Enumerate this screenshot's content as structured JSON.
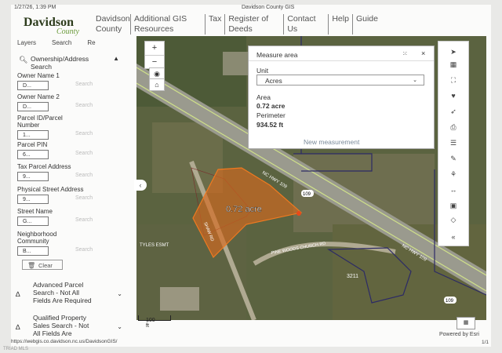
{
  "print_header": {
    "datetime": "1/27/26, 1:39 PM",
    "title": "Davidson County GIS"
  },
  "logo": {
    "name": "Davidson",
    "sub": "County"
  },
  "nav": [
    "Davidson County",
    "Additional GIS Resources",
    "Tax",
    "Register of Deeds",
    "Contact Us",
    "Help",
    "Guide"
  ],
  "tabs": [
    "Layers",
    "Search",
    "Re"
  ],
  "sidebar": {
    "section_title": "Ownership/Address Search",
    "fields": [
      {
        "label": "Owner Name 1",
        "value": "D...",
        "search": "Search"
      },
      {
        "label": "Owner Name 2",
        "value": "D...",
        "search": "Search"
      },
      {
        "label": "Parcel ID/Parcel Number",
        "value": "1...",
        "search": "Search"
      },
      {
        "label": "Parcel PIN",
        "value": "6...",
        "search": "Search"
      },
      {
        "label": "Tax Parcel Address",
        "value": "9...",
        "search": "Search"
      },
      {
        "label": "Physical Street Address",
        "value": "9...",
        "search": "Search"
      },
      {
        "label": "Street Name",
        "value": "G...",
        "search": "Search"
      },
      {
        "label": "Neighborhood Community",
        "value": "B...",
        "search": "Search"
      }
    ],
    "clear_label": "Clear",
    "accordions": [
      {
        "label": "Advanced Parcel Search - Not All Fields Are Required"
      },
      {
        "label": "Qualified Property Sales Search - Not All Fields Are"
      }
    ]
  },
  "map": {
    "parcel_label": "0.72 acre",
    "road_labels": [
      "NC HWY 109",
      "PINE WOODS CHURCH RD",
      "SHAW RD",
      "3211",
      "109",
      "109",
      "TYLES ESMT"
    ],
    "scale_label": "100 ft",
    "attribution": "Powered by Esri"
  },
  "measure": {
    "title": "Measure area",
    "unit_label": "Unit",
    "unit_value": "Acres",
    "area_label": "Area",
    "area_value": "0.72 acre",
    "perimeter_label": "Perimeter",
    "perimeter_value": "934.52 ft",
    "new_label": "New measurement"
  },
  "footer": {
    "url": "https://webgis.co.davidson.nc.us/DavidsonGIS/",
    "page": "1/1",
    "watermark": "TRIAD MLS"
  }
}
